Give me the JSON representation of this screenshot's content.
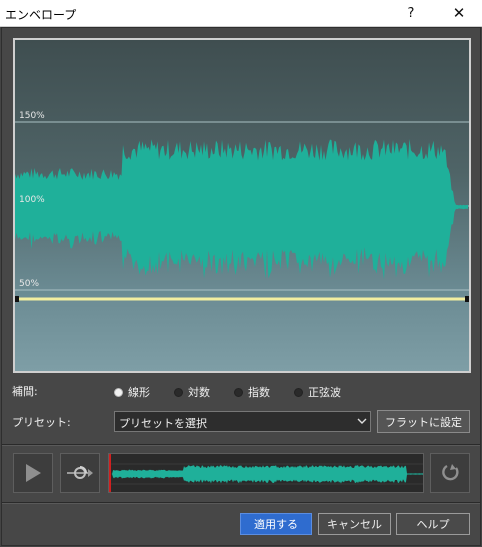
{
  "window": {
    "title": "エンベロープ",
    "help_glyph": "?",
    "close_glyph": "✕"
  },
  "envelope": {
    "scale_labels": [
      "150%",
      "100%",
      "50%"
    ],
    "colors": {
      "wave": "#1fb09a",
      "line": "#f3eea0",
      "frame": "#cfcfcf"
    }
  },
  "interpolation": {
    "label": "補間:",
    "options": [
      {
        "label": "線形",
        "selected": true
      },
      {
        "label": "対数",
        "selected": false
      },
      {
        "label": "指数",
        "selected": false
      },
      {
        "label": "正弦波",
        "selected": false
      }
    ]
  },
  "preset": {
    "label": "プリセット:",
    "selected": "プリセットを選択",
    "flat_button": "フラットに設定"
  },
  "transport": {
    "play_icon": "play-icon",
    "loop_icon": "loop-play-icon",
    "refresh_icon": "refresh-icon"
  },
  "footer": {
    "apply": "適用する",
    "cancel": "キャンセル",
    "help": "ヘルプ"
  }
}
